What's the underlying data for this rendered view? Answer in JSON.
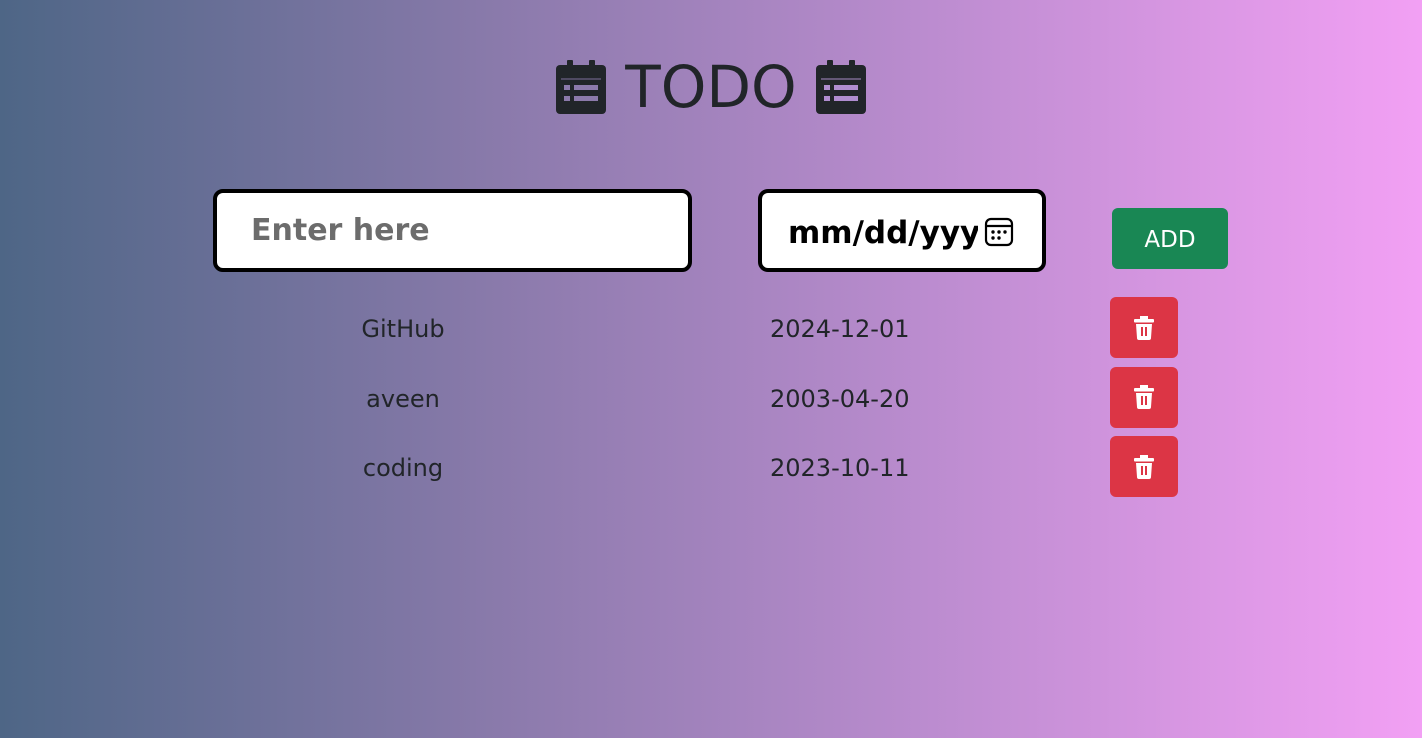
{
  "header": {
    "title": "TODO",
    "left_icon": "calendar-list-icon",
    "right_icon": "calendar-list-icon"
  },
  "form": {
    "todo_placeholder": "Enter here",
    "date_placeholder": "mm/dd/yyyy",
    "date_picker_icon": "calendar-icon",
    "add_label": "ADD"
  },
  "todos": [
    {
      "name": "GitHub",
      "date": "2024-12-01",
      "delete_icon": "trash-icon"
    },
    {
      "name": "aveen",
      "date": "2003-04-20",
      "delete_icon": "trash-icon"
    },
    {
      "name": "coding",
      "date": "2023-10-11",
      "delete_icon": "trash-icon"
    }
  ],
  "colors": {
    "add_button": "#198754",
    "delete_button": "#dc3545",
    "gradient_start": "#4e6686",
    "gradient_end": "#f2a0f4"
  }
}
